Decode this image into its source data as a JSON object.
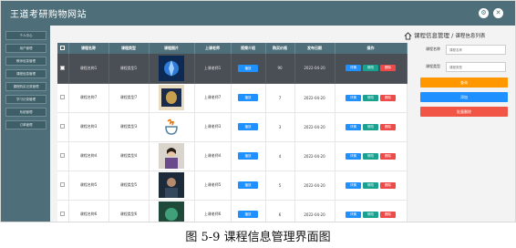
{
  "app": {
    "title": "王道考研购物网站"
  },
  "topbar": {
    "icons": [
      "settings-icon",
      "close-icon"
    ]
  },
  "sidebar": {
    "items": [
      {
        "label": "个人中心"
      },
      {
        "label": "用户管理"
      },
      {
        "label": "教师信息管理"
      },
      {
        "label": "课程信息管理"
      },
      {
        "label": "课程购买记录管理"
      },
      {
        "label": "学习记录管理"
      },
      {
        "label": "系统管理"
      },
      {
        "label": "订单管理"
      }
    ]
  },
  "breadcrumb": {
    "parts": [
      "课程信息管理",
      "课程信息列表"
    ],
    "separator": " / "
  },
  "table": {
    "headers": [
      "课程名称",
      "课程类型",
      "课程图片",
      "上课老师",
      "视频介绍",
      "购买价格",
      "发布日期",
      "操作"
    ],
    "rows": [
      {
        "name": "课程名称1",
        "type": "课程类型1",
        "teacher": "上课老师1",
        "video_btn": "播放",
        "price": "90",
        "date": "2022-04-20",
        "theme": "blue"
      },
      {
        "name": "课程名称7",
        "type": "课程类型7",
        "teacher": "上课老师7",
        "video_btn": "播放",
        "price": "7",
        "date": "2022-04-20",
        "theme": "vase"
      },
      {
        "name": "课程名称3",
        "type": "课程类型3",
        "teacher": "上课老师3",
        "video_btn": "播放",
        "price": "3",
        "date": "2022-04-20",
        "theme": "java"
      },
      {
        "name": "课程名称4",
        "type": "课程类型4",
        "teacher": "上课老师4",
        "video_btn": "播放",
        "price": "4",
        "date": "2022-04-20",
        "theme": "teacher"
      },
      {
        "name": "课程名称5",
        "type": "课程类型5",
        "teacher": "上课老师5",
        "video_btn": "播放",
        "price": "5",
        "date": "2022-04-20",
        "theme": "dark"
      },
      {
        "name": "课程名称6",
        "type": "课程类型6",
        "teacher": "上课老师6",
        "video_btn": "播放",
        "price": "6",
        "date": "2022-04-20",
        "theme": "green"
      }
    ],
    "actions": {
      "detail": "详情",
      "edit": "修改",
      "delete": "删除"
    }
  },
  "search_panel": {
    "fields": [
      {
        "label": "课程名称",
        "placeholder": "课程名称"
      },
      {
        "label": "课程类型",
        "placeholder": "课程类型"
      }
    ],
    "buttons": {
      "search": "查询",
      "add": "添加",
      "batch_delete": "批量删除"
    }
  },
  "caption": "图 5-9 课程信息管理界面图",
  "colors": {
    "header_bg": "#4e6f79",
    "primary": "#1e90ff",
    "edit": "#1aa18f",
    "danger": "#ef4a4a",
    "warning": "#ff9800"
  }
}
